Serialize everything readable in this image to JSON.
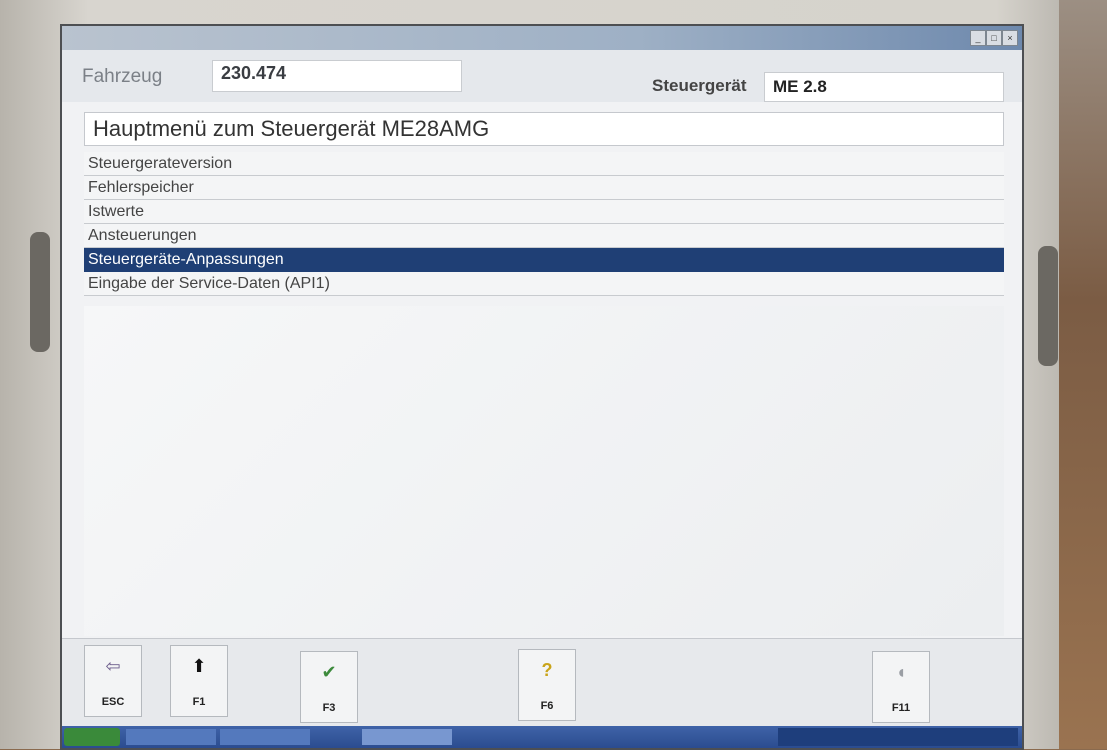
{
  "window": {
    "title_text": "",
    "minimize_label": "_",
    "maximize_label": "□",
    "close_label": "×"
  },
  "header": {
    "fahrzeug_label": "Fahrzeug",
    "fahrzeug_value": "230.474",
    "steuergeraet_label": "Steuergerät",
    "steuergeraet_value": "ME 2.8"
  },
  "main": {
    "title": "Hauptmenü zum Steuergerät ME28AMG",
    "items": [
      {
        "label": "Steuergerateversion",
        "selected": false
      },
      {
        "label": "Fehlerspeicher",
        "selected": false
      },
      {
        "label": "Istwerte",
        "selected": false
      },
      {
        "label": "Ansteuerungen",
        "selected": false
      },
      {
        "label": "Steuergeräte-Anpassungen",
        "selected": true
      },
      {
        "label": "Eingabe der Service-Daten (API1)",
        "selected": false
      }
    ]
  },
  "toolbar": {
    "keys": [
      {
        "label": "ESC",
        "icon": "exit-door-icon",
        "glyph": "⇦"
      },
      {
        "label": "F1",
        "icon": "arrow-up-icon",
        "glyph": "⬆"
      },
      {
        "label": "F3",
        "icon": "checkmark-icon",
        "glyph": "✔"
      },
      {
        "label": "F6",
        "icon": "help-icon",
        "glyph": "?"
      },
      {
        "label": "F11",
        "icon": "eraser-icon",
        "glyph": "◖"
      }
    ]
  },
  "colors": {
    "selection": "#1f3f75",
    "accent_green": "#3c8a3c"
  },
  "taskbar": {
    "start_label": "",
    "tasks": [
      "",
      "",
      ""
    ],
    "tray_text": ""
  }
}
